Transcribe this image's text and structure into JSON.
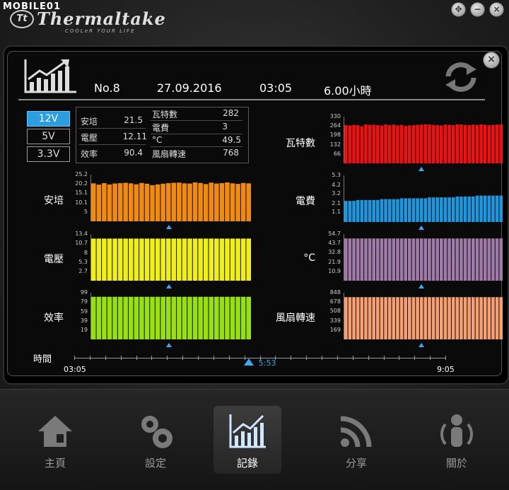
{
  "watermark": "MOBILE01",
  "brand": {
    "badge": "Tt",
    "name": "Thermaltake",
    "tagline": "COOLeR YOUR LIFE"
  },
  "window_buttons": [
    "move-icon",
    "minimize-icon",
    "close-icon"
  ],
  "header": {
    "no": "No.8",
    "date": "27.09.2016",
    "time": "03:05",
    "duration": "6.00小時"
  },
  "voltage_tabs": [
    {
      "label": "12V",
      "active": true
    },
    {
      "label": "5V",
      "active": false
    },
    {
      "label": "3.3V",
      "active": false
    }
  ],
  "stats": {
    "left": [
      {
        "label": "安培",
        "value": "21.5"
      },
      {
        "label": "電壓",
        "value": "12.11"
      },
      {
        "label": "效率",
        "value": "90.4"
      }
    ],
    "right": [
      {
        "label": "瓦特數",
        "value": "282"
      },
      {
        "label": "電費",
        "value": "3"
      },
      {
        "label": "°C",
        "value": "49.5"
      },
      {
        "label": "風扇轉速",
        "value": "768"
      }
    ]
  },
  "colors": {
    "amps": "#f08a10",
    "volts": "#f0f018",
    "eff": "#98e010",
    "watts": "#f01010",
    "cost": "#1c98e0",
    "temp": "#a07aa8",
    "fan": "#f8a070",
    "accent": "#3aa8f0"
  },
  "charts": {
    "amps": {
      "label": "安培",
      "ticks": [
        "25.2",
        "20.2",
        "15.1",
        "10.1",
        "5"
      ],
      "ymax": 25.2,
      "values": [
        20.5,
        19.8,
        20.6,
        19.9,
        20.4,
        20.6,
        20.8,
        20.5,
        20.0,
        20.7,
        20.3,
        19.5,
        19.9,
        20.3,
        20.6,
        20.8,
        20.9,
        20.5,
        20.4,
        21.0,
        20.7,
        20.1,
        20.9,
        20.4,
        20.6,
        21.0,
        20.5,
        20.2,
        20.7,
        20.5
      ]
    },
    "volts": {
      "label": "電壓",
      "ticks": [
        "13.4",
        "10.7",
        "8",
        "5.3",
        "2.7"
      ],
      "ymax": 13.4,
      "values": [
        12.1,
        12.1,
        12.1,
        12.1,
        12.1,
        12.1,
        12.1,
        12.1,
        12.1,
        12.1,
        12.1,
        12.1,
        12.1,
        12.1,
        12.1,
        12.1,
        12.1,
        12.1,
        12.1,
        12.1,
        12.1,
        12.1,
        12.1,
        12.1,
        12.1,
        12.1,
        12.1,
        12.1,
        12.1,
        12.1
      ]
    },
    "eff": {
      "label": "效率",
      "ticks": [
        "99",
        "79",
        "59",
        "39",
        "19"
      ],
      "ymax": 99,
      "values": [
        90.4,
        90.4,
        90.4,
        90.4,
        90.4,
        90.4,
        90.4,
        90.4,
        90.4,
        90.4,
        90.4,
        90.4,
        90.4,
        90.4,
        90.4,
        90.4,
        90.4,
        90.4,
        90.4,
        90.4,
        90.4,
        90.4,
        90.4,
        90.4,
        90.4,
        90.4,
        90.4,
        90.4,
        90.4,
        90.4
      ]
    },
    "watts": {
      "label": "瓦特數",
      "ticks": [
        "330",
        "264",
        "198",
        "132",
        "66"
      ],
      "ymax": 330,
      "values": [
        270,
        268,
        272,
        270,
        262,
        275,
        272,
        273,
        270,
        268,
        275,
        270,
        274,
        268,
        272,
        265,
        268,
        270,
        272,
        274,
        276,
        275,
        272,
        270,
        268,
        274,
        272,
        270,
        276,
        275,
        272,
        270,
        274,
        272,
        275,
        273,
        270,
        272,
        274,
        276
      ]
    },
    "cost": {
      "label": "電費",
      "ticks": [
        "5.3",
        "4.2",
        "3.2",
        "2.1",
        "1.1"
      ],
      "ymax": 5.3,
      "values": [
        2.4,
        2.4,
        2.4,
        2.5,
        2.5,
        2.5,
        2.5,
        2.5,
        2.5,
        2.6,
        2.6,
        2.6,
        2.6,
        2.6,
        2.7,
        2.7,
        2.7,
        2.7,
        2.7,
        2.7,
        2.7,
        2.8,
        2.8,
        2.8,
        2.8,
        2.8,
        2.8,
        2.8,
        2.9,
        2.9,
        2.9,
        2.9,
        2.9,
        3.0,
        3.0,
        3.0,
        3.0,
        3.0,
        3.0,
        3.0
      ]
    },
    "temp": {
      "label": "°C",
      "ticks": [
        "54.7",
        "43.7",
        "32.8",
        "21.9",
        "10.9"
      ],
      "ymax": 54.7,
      "values": [
        49.5,
        49.5,
        49.5,
        49.5,
        49.5,
        49.5,
        49.5,
        49.5,
        49.5,
        49.5,
        49.5,
        49.5,
        49.5,
        49.5,
        49.5,
        49.5,
        49.5,
        49.5,
        49.5,
        49.5,
        49.5,
        49.5,
        49.5,
        49.5,
        49.5,
        49.5,
        49.5,
        49.5,
        49.5,
        49.5,
        49.5,
        49.5,
        49.5,
        49.5,
        49.5,
        49.5,
        49.5,
        49.5,
        49.5,
        49.5
      ]
    },
    "fan": {
      "label": "風扇轉速",
      "ticks": [
        "848",
        "678",
        "508",
        "339",
        "169"
      ],
      "ymax": 848,
      "values": [
        768,
        768,
        768,
        768,
        768,
        768,
        768,
        768,
        768,
        768,
        768,
        768,
        768,
        768,
        768,
        768,
        768,
        768,
        768,
        768,
        768,
        768,
        768,
        768,
        768,
        768,
        768,
        768,
        768,
        768,
        768,
        768,
        768,
        768,
        768,
        768,
        768,
        768,
        768,
        768
      ]
    }
  },
  "timeline": {
    "label": "時間",
    "start": "03:05",
    "end": "9:05",
    "current": "5:53",
    "position": 0.47
  },
  "nav": [
    {
      "label": "主頁",
      "icon": "home-icon",
      "active": false
    },
    {
      "label": "設定",
      "icon": "gears-icon",
      "active": false
    },
    {
      "label": "記錄",
      "icon": "chart-log-icon",
      "active": true
    },
    {
      "label": "分享",
      "icon": "rss-share-icon",
      "active": false
    },
    {
      "label": "關於",
      "icon": "about-person-icon",
      "active": false
    }
  ]
}
